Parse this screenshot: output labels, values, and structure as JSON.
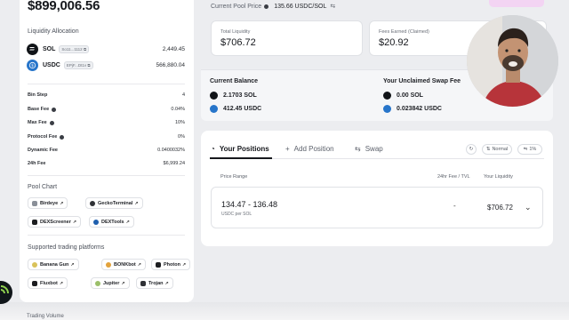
{
  "sidebar": {
    "total_value": "$899,006.56",
    "liquidity_allocation_title": "Liquidity Allocation",
    "tokens": [
      {
        "symbol": "SOL",
        "address": "So11...1112",
        "amount": "2,449.45",
        "icon": "sol-icon",
        "color": "#111418"
      },
      {
        "symbol": "USDC",
        "address": "EPjF...Dt1v",
        "amount": "566,880.04",
        "icon": "usdc-icon",
        "color": "#2775ca"
      }
    ],
    "fees": [
      {
        "label": "Bin Step",
        "value": "4",
        "info": false
      },
      {
        "label": "Base Fee",
        "value": "0.04%",
        "info": true
      },
      {
        "label": "Max Fee",
        "value": "10%",
        "info": true
      },
      {
        "label": "Protocol Fee",
        "value": "0%",
        "info": true
      },
      {
        "label": "Dynamic Fee",
        "value": "0.0400032%",
        "info": false
      },
      {
        "label": "24h Fee",
        "value": "$6,999.24",
        "info": false
      }
    ],
    "pool_chart_title": "Pool Chart",
    "pool_chart_links": [
      "Birdeye",
      "GeckoTerminal",
      "DEXScreener",
      "DEXTools"
    ],
    "trading_platforms_title": "Supported trading platforms",
    "trading_platforms": [
      "Banana Gun",
      "BONKbot",
      "Photon",
      "Fluxbot",
      "Jupiter",
      "Trojan"
    ],
    "bottom_label": "Trading Volume"
  },
  "header": {
    "pool_price_label": "Current Pool Price",
    "pool_price_value": "135.66 USDC/SOL"
  },
  "stats": {
    "total_liquidity_label": "Total Liquidity",
    "total_liquidity_value": "$706.72",
    "fees_earned_label": "Fees Earned (Claimed)",
    "fees_earned_value": "$20.92"
  },
  "balance": {
    "current_title": "Current Balance",
    "current_sol": "2.1703 SOL",
    "current_usdc": "412.45 USDC",
    "unclaimed_title": "Your Unclaimed Swap Fee",
    "unclaimed_sol": "0.00 SOL",
    "unclaimed_usdc": "0.023842 USDC"
  },
  "positions": {
    "tabs": [
      "Your Positions",
      "Add Position",
      "Swap"
    ],
    "refresh_icon": "refresh-icon",
    "mode_label": "Normal",
    "slippage_label": "1%",
    "columns": [
      "Price Range",
      "24hr Fee / TVL",
      "Your Liquidity"
    ],
    "rows": [
      {
        "range": "134.47 - 136.48",
        "unit": "USDC per SOL",
        "fee_tvl": "-",
        "liquidity": "$706.72"
      }
    ]
  },
  "colors": {
    "accent": "#16181d",
    "pink": "#f3d4f3",
    "usdc": "#2775ca"
  }
}
